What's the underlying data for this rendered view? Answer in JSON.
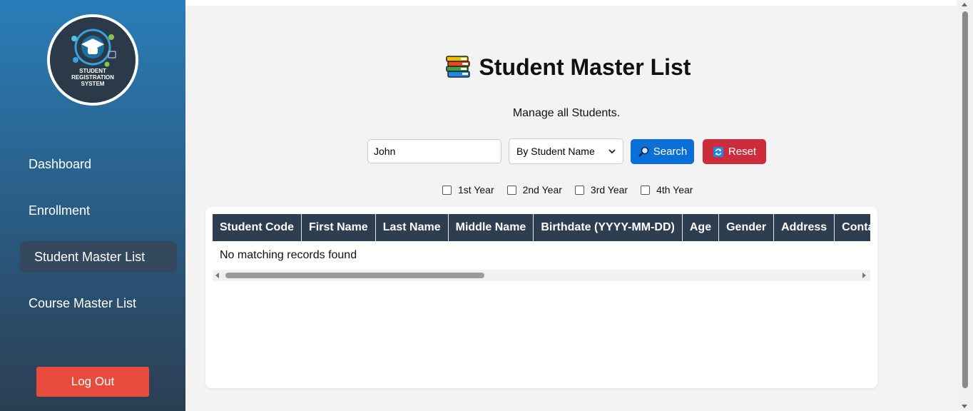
{
  "sidebar": {
    "logo": {
      "text_line1": "STUDENT",
      "text_line2": "REGISTRATION",
      "text_line3": "SYSTEM"
    },
    "items": [
      {
        "label": "Dashboard",
        "active": false
      },
      {
        "label": "Enrollment",
        "active": false
      },
      {
        "label": "Student Master List",
        "active": true
      },
      {
        "label": "Course Master List",
        "active": false
      }
    ],
    "logout_label": "Log Out"
  },
  "main": {
    "title": "Student Master List",
    "title_icon": "books-icon",
    "subtitle": "Manage all Students.",
    "search": {
      "value": "John",
      "filter_selected": "By Student Name",
      "search_label": "Search",
      "reset_label": "Reset"
    },
    "year_filters": [
      {
        "label": "1st Year",
        "checked": false
      },
      {
        "label": "2nd Year",
        "checked": false
      },
      {
        "label": "3rd Year",
        "checked": false
      },
      {
        "label": "4th Year",
        "checked": false
      }
    ],
    "table": {
      "columns": [
        "Student Code",
        "First Name",
        "Last Name",
        "Middle Name",
        "Birthdate (YYYY-MM-DD)",
        "Age",
        "Gender",
        "Address",
        "Contact"
      ],
      "empty_message": "No matching records found"
    }
  },
  "colors": {
    "sidebar_top": "#2a7db8",
    "sidebar_bottom": "#2b3e52",
    "active_nav": "#34495e",
    "logout": "#e74c3c",
    "search_button": "#0b6fd8",
    "reset_button": "#cc2d3c",
    "table_header": "#2c3e50"
  }
}
